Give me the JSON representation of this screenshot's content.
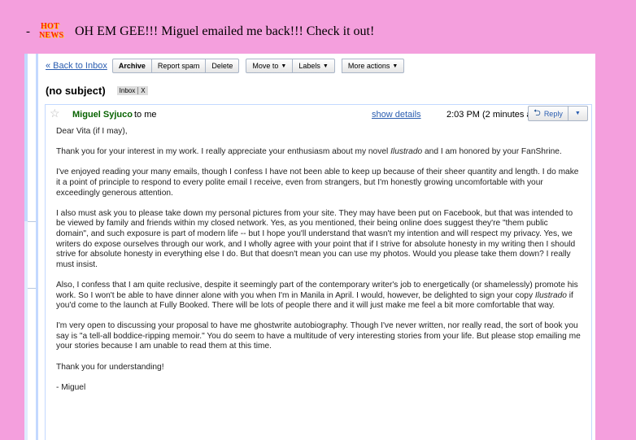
{
  "headline": {
    "dash": "-",
    "hot_news_top": "HOT",
    "hot_news_bottom": "NEWS",
    "text": "OH EM GEE!!! Miguel emailed me back!!! Check it out!"
  },
  "toolbar": {
    "back_link": "« Back to Inbox",
    "archive": "Archive",
    "report_spam": "Report spam",
    "delete": "Delete",
    "move_to": "Move to",
    "labels": "Labels",
    "more_actions": "More actions",
    "caret": "▼"
  },
  "conversation": {
    "subject": "(no subject)",
    "label": "Inbox",
    "label_remove": "X"
  },
  "message": {
    "star": "☆",
    "sender": "Miguel Syjuco",
    "to": "to me",
    "show_details": "show details",
    "time": "2:03 PM (2 minutes ago)",
    "reply": "Reply",
    "reply_arrow": "⮌",
    "more": "▼",
    "body": {
      "greeting": "Dear Vita (if I may),",
      "p1_a": "Thank you for your interest in my work. I really appreciate your enthusiasm about my novel ",
      "p1_book": "Ilustrado",
      "p1_b": " and I am honored by your FanShrine.",
      "p2": "I've enjoyed reading your many emails, though I confess I have not been able to keep up because of their sheer quantity and length. I do make it a point of principle to respond to every polite email I receive, even from strangers, but I'm honestly growing uncomfortable with your exceedingly generous attention.",
      "p3": "I also must ask you to please take down my personal pictures from your site. They may have been put on Facebook, but that was intended to be viewed by family and friends within my closed network. Yes, as you mentioned, their being online does suggest they're \"them public domain\", and such exposure is part of modern life -- but I hope you'll understand that wasn't my intention and will respect my privacy. Yes, we writers do expose ourselves through our work, and I wholly agree with your point that if I strive for absolute honesty in my writing then I should strive for absolute honesty in everything else I do. But that doesn't mean you can use my photos. Would you please take them down? I really must insist.",
      "p4_a": "Also, I confess that I am quite reclusive, despite it seemingly part of the contemporary writer's job to energetically (or shamelessly) promote his work. So I won't be able to have dinner alone with you when I'm in Manila in April. I would, however, be delighted to sign your copy ",
      "p4_book": "Ilustrado",
      "p4_b": " if you'd come to the launch at Fully Booked. There will be lots of people there and it will just make me feel a bit more comfortable that way.",
      "p5": "I'm very open to discussing your proposal to have me ghostwrite autobiography. Though I've never written, nor really read, the sort of book you say is \"a tell-all boddice-ripping memoir.\" You do seem to have a multitude of very interesting stories from your life. But please stop emailing me your stories because I am unable to read them at this time.",
      "p6": "Thank you for understanding!",
      "signature": "- Miguel"
    }
  }
}
